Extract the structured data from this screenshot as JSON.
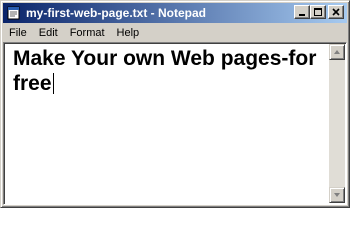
{
  "window": {
    "title": "my-first-web-page.txt - Notepad",
    "minimize_glyph": "_",
    "maximize_glyph": "□",
    "close_glyph": "×"
  },
  "menubar": {
    "items": [
      "File",
      "Edit",
      "Format",
      "Help"
    ]
  },
  "editor": {
    "content": "Make Your own Web pages-for free"
  },
  "icons": {
    "app": "notepad-icon",
    "scroll_up": "arrow-up-icon",
    "scroll_down": "arrow-down-icon"
  },
  "colors": {
    "titlebar_start": "#0a246a",
    "titlebar_end": "#a6caf0",
    "chrome": "#d4d0c8"
  }
}
